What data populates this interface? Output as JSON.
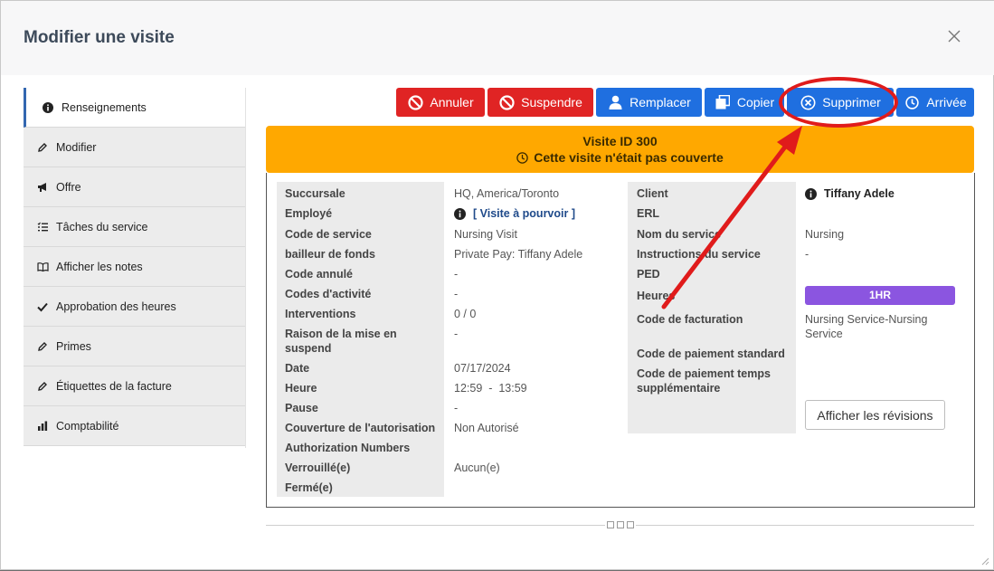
{
  "modal": {
    "title": "Modifier une visite"
  },
  "sidebar": {
    "items": [
      {
        "label": "Renseignements",
        "icon": "info-icon"
      },
      {
        "label": "Modifier",
        "icon": "pencil-icon"
      },
      {
        "label": "Offre",
        "icon": "megaphone-icon"
      },
      {
        "label": "Tâches du service",
        "icon": "task-list-icon"
      },
      {
        "label": "Afficher les notes",
        "icon": "book-icon"
      },
      {
        "label": "Approbation des heures",
        "icon": "check-icon"
      },
      {
        "label": "Primes",
        "icon": "pencil-icon"
      },
      {
        "label": "Étiquettes de la facture",
        "icon": "pencil-icon"
      },
      {
        "label": "Comptabilité",
        "icon": "bar-chart-icon"
      }
    ]
  },
  "toolbar": {
    "annuler": "Annuler",
    "suspendre": "Suspendre",
    "remplacer": "Remplacer",
    "copier": "Copier",
    "supprimer": "Supprimer",
    "arrivee": "Arrivée"
  },
  "banner": {
    "line1": "Visite ID 300",
    "line2": "Cette visite n'était pas couverte"
  },
  "left_fields": [
    {
      "label": "Succursale",
      "value": "HQ, America/Toronto"
    },
    {
      "label": "Employé",
      "value": "[ Visite à pourvoir ]"
    },
    {
      "label": "Code de service",
      "value": "Nursing Visit"
    },
    {
      "label": "bailleur de fonds",
      "value": "Private Pay: Tiffany Adele"
    },
    {
      "label": "Code annulé",
      "value": "-"
    },
    {
      "label": "Codes d'activité",
      "value": "-"
    },
    {
      "label": "Interventions",
      "value": "0 / 0"
    },
    {
      "label": "Raison de la mise en suspend",
      "value": "-"
    },
    {
      "label": "Date",
      "value": "07/17/2024"
    },
    {
      "label": "Heure",
      "value": "12:59  -  13:59"
    },
    {
      "label": "Pause",
      "value": "-"
    },
    {
      "label": "Couverture de l'autorisation",
      "value": "Non Autorisé"
    },
    {
      "label": "Authorization Numbers",
      "value": ""
    },
    {
      "label": "Verrouillé(e)",
      "value": "Aucun(e)"
    },
    {
      "label": "Fermé(e)",
      "value": ""
    }
  ],
  "right_fields": [
    {
      "label": "Client",
      "value": "Tiffany Adele"
    },
    {
      "label": "ERL",
      "value": ""
    },
    {
      "label": "Nom du service",
      "value": "Nursing"
    },
    {
      "label": "Instructions du service",
      "value": "-"
    },
    {
      "label": "PED",
      "value": ""
    },
    {
      "label": "Heures",
      "value": "1HR"
    },
    {
      "label": "Code de facturation",
      "value": "Nursing Service-Nursing Service"
    },
    {
      "label": "Code de paiement standard",
      "value": ""
    },
    {
      "label": "Code de paiement temps supplémentaire",
      "value": ""
    }
  ],
  "revisions_button": "Afficher les révisions",
  "colors": {
    "danger": "#e02424",
    "primary": "#1f6fe0",
    "warning": "#ffa800",
    "badge": "#8b55e0",
    "annotation": "#e01b1b"
  }
}
